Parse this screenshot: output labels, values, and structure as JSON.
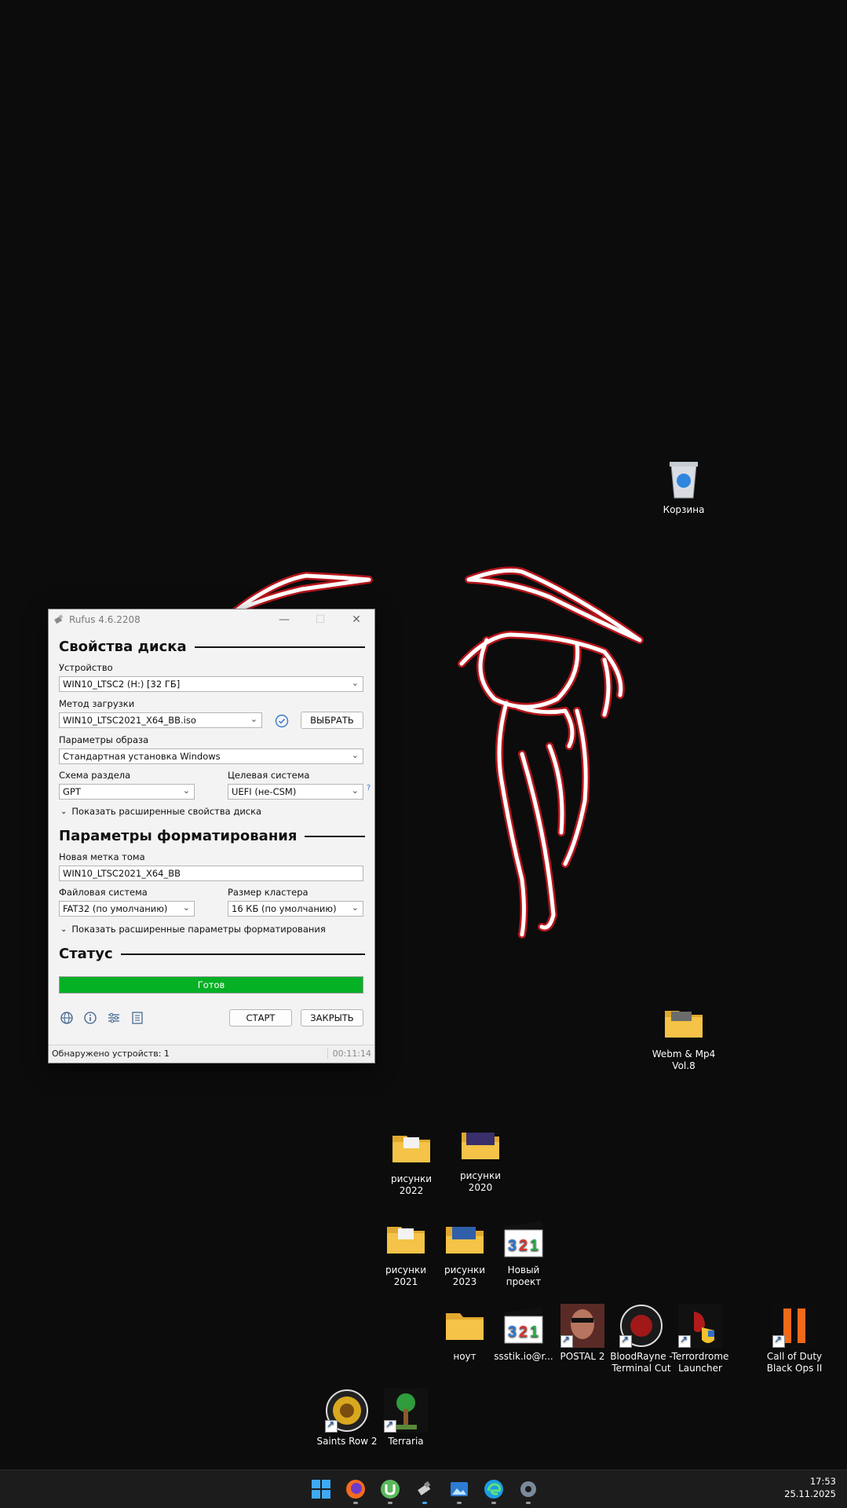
{
  "window": {
    "title": "Rufus 4.6.2208",
    "drive_section": "Свойства диска",
    "device_label": "Устройство",
    "device_value": "WIN10_LTSC2 (H:) [32 ГБ]",
    "boot_label": "Метод загрузки",
    "boot_value": "WIN10_LTSC2021_X64_BB.iso",
    "select_btn": "ВЫБРАТЬ",
    "image_label": "Параметры образа",
    "image_value": "Стандартная установка Windows",
    "partition_label": "Схема раздела",
    "partition_value": "GPT",
    "target_label": "Целевая система",
    "target_value": "UEFI (не-CSM)",
    "help_mark": "?",
    "adv_drive": "Показать расширенные свойства диска",
    "format_section": "Параметры форматирования",
    "volume_label": "Новая метка тома",
    "volume_value": "WIN10_LTSC2021_X64_BB",
    "fs_label": "Файловая система",
    "fs_value": "FAT32 (по умолчанию)",
    "cluster_label": "Размер кластера",
    "cluster_value": "16 КБ (по умолчанию)",
    "adv_format": "Показать расширенные параметры форматирования",
    "status_section": "Статус",
    "progress_text": "Готов",
    "start_btn": "СТАРТ",
    "close_btn": "ЗАКРЫТЬ",
    "status_left": "Обнаружено устройств: 1",
    "status_right": "00:11:14"
  },
  "desktop": {
    "recycle": "Корзина",
    "webm": "Webm & Mp4 Vol.8",
    "ris2022": "рисунки 2022",
    "ris2020": "рисунки 2020",
    "ris2021": "рисунки 2021",
    "ris2023": "рисунки 2023",
    "newproj": "Новый проект",
    "nout": "ноут",
    "ssstik": "ssstik.io@r...",
    "postal": "POSTAL 2",
    "bloodrayne": "BloodRayne - Terminal Cut",
    "terrordrome": "Terrordrome Launcher",
    "cod": "Call of Duty Black Ops II",
    "saints": "Saints Row 2",
    "terraria": "Terraria"
  },
  "taskbar": {
    "time": "17:53",
    "date": "25.11.2025"
  },
  "colors": {
    "progress": "#06b025",
    "folder": "#f4c347",
    "taskbar": "#1c1c1c"
  }
}
